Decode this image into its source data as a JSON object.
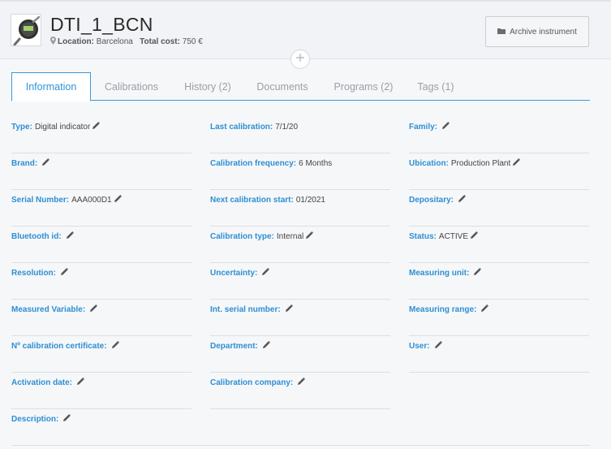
{
  "header": {
    "title": "DTI_1_BCN",
    "location_label": "Location:",
    "location_value": "Barcelona",
    "cost_label": "Total cost:",
    "cost_value": "750 €",
    "archive_label": "Archive instrument"
  },
  "tabs": [
    {
      "label": "Information",
      "active": true
    },
    {
      "label": "Calibrations"
    },
    {
      "label": "History (2)"
    },
    {
      "label": "Documents"
    },
    {
      "label": "Programs (2)"
    },
    {
      "label": "Tags (1)"
    }
  ],
  "fields": {
    "col1": [
      {
        "label": "Type:",
        "value": "Digital indicator"
      },
      {
        "label": "Brand:",
        "value": ""
      },
      {
        "label": "Serial Number:",
        "value": "AAA000D1"
      },
      {
        "label": "Bluetooth id:",
        "value": ""
      },
      {
        "label": "Resolution:",
        "value": ""
      },
      {
        "label": "Measured Variable:",
        "value": ""
      },
      {
        "label": "Nº calibration certificate:",
        "value": ""
      },
      {
        "label": "Activation date:",
        "value": ""
      },
      {
        "label": "Description:",
        "value": ""
      }
    ],
    "col2": [
      {
        "label": "Last calibration:",
        "value": "7/1/20"
      },
      {
        "label": "Calibration frequency:",
        "value": "6 Months"
      },
      {
        "label": "Next calibration start:",
        "value": "01/2021"
      },
      {
        "label": "Calibration type:",
        "value": "Internal"
      },
      {
        "label": "Uncertainty:",
        "value": ""
      },
      {
        "label": "Int. serial number:",
        "value": ""
      },
      {
        "label": "Department:",
        "value": ""
      },
      {
        "label": "Calibration company:",
        "value": ""
      }
    ],
    "col3": [
      {
        "label": "Family:",
        "value": ""
      },
      {
        "label": "Ubication:",
        "value": "Production Plant"
      },
      {
        "label": "Depositary:",
        "value": ""
      },
      {
        "label": "Status:",
        "value": "ACTIVE"
      },
      {
        "label": "Measuring unit:",
        "value": ""
      },
      {
        "label": "Measuring range:",
        "value": ""
      },
      {
        "label": "User:",
        "value": ""
      }
    ]
  },
  "colors": {
    "accent": "#2d95d6",
    "label": "#2d8fd2",
    "header_bg": "#f1f3f6"
  },
  "icons": {
    "thumb": "digital-indicator-image",
    "location": "map-pin-icon",
    "archive": "folder-icon",
    "add": "plus-icon",
    "edit": "pencil-icon"
  }
}
